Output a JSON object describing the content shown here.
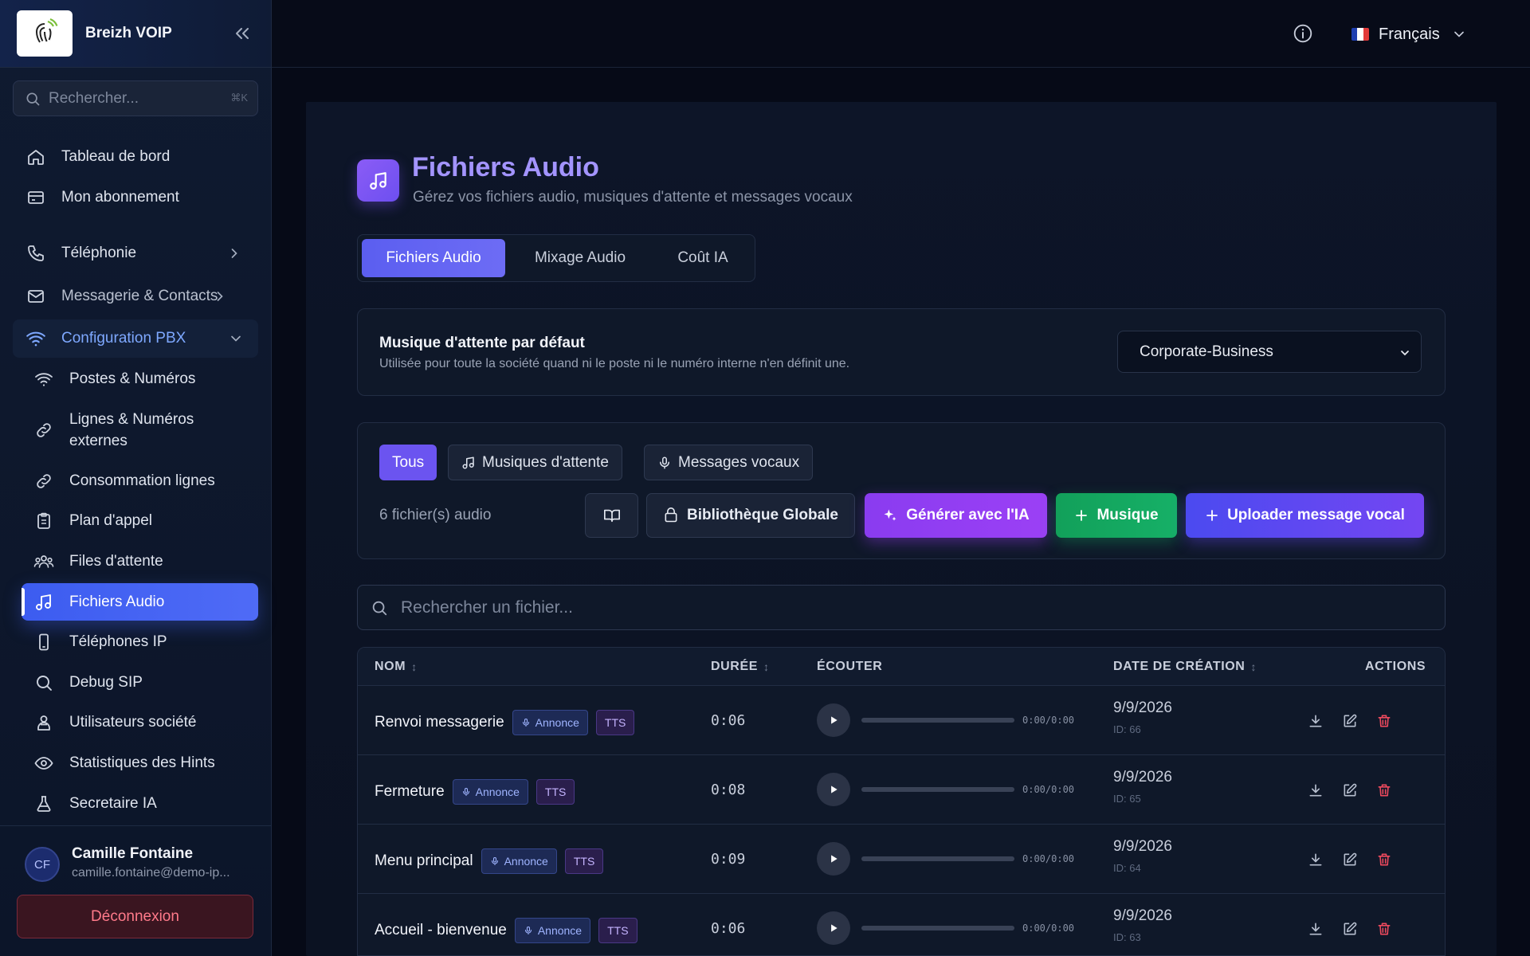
{
  "app": {
    "name": "Breizh VOIP"
  },
  "sidebar": {
    "search_placeholder": "Rechercher...",
    "search_shortcut": "⌘K",
    "top_items": [
      {
        "label": "Tableau de bord",
        "icon": "home-icon"
      },
      {
        "label": "Mon abonnement",
        "icon": "credit-card-icon"
      }
    ],
    "groups": [
      {
        "label": "Téléphonie",
        "icon": "phone-icon",
        "expanded": false
      },
      {
        "label": "Messagerie & Contacts",
        "icon": "mail-icon",
        "expanded": false
      },
      {
        "label": "Configuration PBX",
        "icon": "wifi-icon",
        "expanded": true
      }
    ],
    "pbx_items": [
      {
        "label": "Postes & Numéros",
        "icon": "wifi-icon"
      },
      {
        "label": "Lignes & Numéros externes",
        "icon": "link-icon"
      },
      {
        "label": "Consommation lignes",
        "icon": "link-icon"
      },
      {
        "label": "Plan d'appel",
        "icon": "clipboard-icon"
      },
      {
        "label": "Files d'attente",
        "icon": "users-icon"
      },
      {
        "label": "Fichiers Audio",
        "icon": "music-icon",
        "active": true
      },
      {
        "label": "Téléphones IP",
        "icon": "smartphone-icon"
      },
      {
        "label": "Debug SIP",
        "icon": "search-icon"
      },
      {
        "label": "Utilisateurs société",
        "icon": "user-group-icon"
      },
      {
        "label": "Statistiques des Hints",
        "icon": "eye-icon"
      },
      {
        "label": "Secretaire IA",
        "icon": "flask-icon"
      }
    ],
    "user": {
      "initials": "CF",
      "name": "Camille Fontaine",
      "email": "camille.fontaine@demo-ip..."
    },
    "logout_label": "Déconnexion"
  },
  "topbar": {
    "language": "Français"
  },
  "page": {
    "title": "Fichiers Audio",
    "subtitle": "Gérez vos fichiers audio, musiques d'attente et messages vocaux",
    "tabs": [
      {
        "label": "Fichiers Audio",
        "active": true
      },
      {
        "label": "Mixage Audio",
        "active": false
      },
      {
        "label": "Coût IA",
        "active": false
      }
    ]
  },
  "moh": {
    "title": "Musique d'attente par défaut",
    "description": "Utilisée pour toute la société quand ni le poste ni le numéro interne n'en définit une.",
    "selected": "Corporate-Business"
  },
  "filters": {
    "items": [
      {
        "label": "Tous",
        "active": true
      },
      {
        "label": "Musiques d'attente",
        "active": false,
        "icon": "music-note-icon"
      },
      {
        "label": "Messages vocaux",
        "active": false,
        "icon": "microphone-icon"
      }
    ],
    "count_text": "6 fichier(s) audio",
    "buttons": {
      "library": "Bibliothèque Globale",
      "generate_ai": "Générer avec l'IA",
      "music": "Musique",
      "upload": "Uploader message vocal"
    }
  },
  "file_search": {
    "placeholder": "Rechercher un fichier..."
  },
  "table": {
    "headers": {
      "name": "NOM",
      "duration": "DURÉE",
      "listen": "ÉCOUTER",
      "created": "DATE DE CRÉATION",
      "actions": "ACTIONS"
    },
    "rows": [
      {
        "name": "Renvoi messagerie",
        "badge_type": "Annonce",
        "badge_tts": "TTS",
        "duration": "0:06",
        "time": "0:00/0:00",
        "date": "9/9/2026",
        "id": "ID: 66"
      },
      {
        "name": "Fermeture",
        "badge_type": "Annonce",
        "badge_tts": "TTS",
        "duration": "0:08",
        "time": "0:00/0:00",
        "date": "9/9/2026",
        "id": "ID: 65"
      },
      {
        "name": "Menu principal",
        "badge_type": "Annonce",
        "badge_tts": "TTS",
        "duration": "0:09",
        "time": "0:00/0:00",
        "date": "9/9/2026",
        "id": "ID: 64"
      },
      {
        "name": "Accueil - bienvenue",
        "badge_type": "Annonce",
        "badge_tts": "TTS",
        "duration": "0:06",
        "time": "0:00/0:00",
        "date": "9/9/2026",
        "id": "ID: 63"
      }
    ]
  },
  "colors": {
    "accent": "#5b5ef0",
    "ai": "#8a3cf0",
    "music": "#12a05a",
    "danger": "#ef4a5e"
  }
}
